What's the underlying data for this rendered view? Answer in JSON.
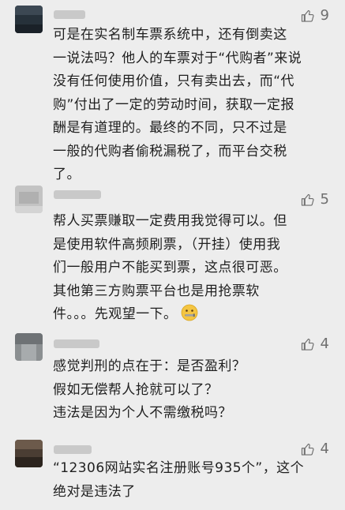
{
  "comments": [
    {
      "likes": "9",
      "lines": [
        "可是在实名制车票系统中，还有倒卖这",
        "一说法吗？他人的车票对于“代购者”来说",
        "没有任何使用价值，只有卖出去，而“代",
        "购”付出了一定的劳动时间，获取一定报",
        "酬是有道理的。最终的不同，只不过是",
        "一般的代购者偷税漏税了，而平台交税",
        "了。"
      ]
    },
    {
      "likes": "5",
      "lines": [
        "帮人买票赚取一定费用我觉得可以。但",
        "是使用软件高频刷票，（开挂）使用我",
        "们一般用户不能买到票，这点很可恶。",
        "其他第三方购票平台也是用抢票软",
        "件。。。先观望一下。"
      ],
      "emoji": "zipper-mouth-face"
    },
    {
      "likes": "4",
      "lines": [
        "感觉判刑的点在于：是否盈利？",
        "假如无偿帮人抢就可以了？",
        "违法是因为个人不需缴税吗？"
      ]
    },
    {
      "likes": "4",
      "lines": [
        "“12306网站实名注册账号935个”，这个",
        "绝对是违法了"
      ]
    }
  ]
}
